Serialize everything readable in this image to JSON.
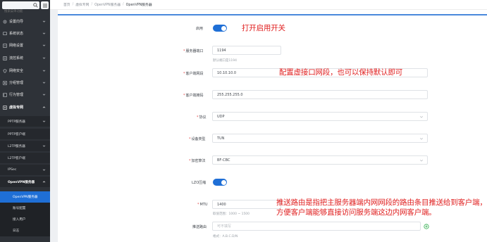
{
  "sidebar": {
    "search_placeholder": "搜索菜单功能",
    "items": [
      {
        "label": "设置向导"
      },
      {
        "label": "系统状态"
      },
      {
        "label": "网络设置"
      },
      {
        "label": "流控系统"
      },
      {
        "label": "网络安全"
      },
      {
        "label": "分组管理"
      },
      {
        "label": "行为管理"
      },
      {
        "label": "虚拟专网"
      }
    ],
    "sub_items": [
      {
        "label": "PPTP服务器"
      },
      {
        "label": "PPTP客户端"
      },
      {
        "label": "L2TP服务器"
      },
      {
        "label": "L2TP客户端"
      },
      {
        "label": "IPSec"
      },
      {
        "label": "OpenVPN服务器"
      }
    ],
    "sub2_items": [
      {
        "label": "OpenVPN服务器"
      },
      {
        "label": "账号配置"
      },
      {
        "label": "接入用户"
      },
      {
        "label": "日志"
      }
    ]
  },
  "breadcrumb": {
    "items": [
      "首页",
      "虚拟专网",
      "OpenVPN服务器",
      "OpenVPN服务器"
    ],
    "separator": "/"
  },
  "form": {
    "enable_label": "启用",
    "enable_on": true,
    "port_label": "服务器端口",
    "port_value": "1194",
    "port_hint": "默认端口是1194",
    "pool_label": "客户端网段",
    "pool_value": "10.10.10.0",
    "mask_label": "客户端掩码",
    "mask_value": "255.255.255.0",
    "protocol_label": "协议",
    "protocol_value": "UDP",
    "device_label": "设备类型",
    "device_value": "TUN",
    "cipher_label": "加密算法",
    "cipher_value": "BF-CBC",
    "lzo_label": "LZO压缩",
    "lzo_on": true,
    "mtu_label": "MTU",
    "mtu_value": "1400",
    "mtu_hint": "取值范围：1000 ~ 1500",
    "route_label": "推送路由",
    "route_placeholder": "可不填写",
    "route_hint": "格式：A.B.C.D/N"
  },
  "annotations": {
    "a1": "打开启用开关",
    "a2": "配置虚接口网段，也可以保持默认即可",
    "a3_line1": "推送路由是指把主服务器端内网网段的路由条目推送给到客户端，",
    "a3_line2": "方便客户端能够直接访问服务端这边内网客户端。"
  },
  "colors": {
    "sidebar_bg": "#2e3238",
    "accent": "#1f6fd6",
    "annotation": "#e02020"
  }
}
